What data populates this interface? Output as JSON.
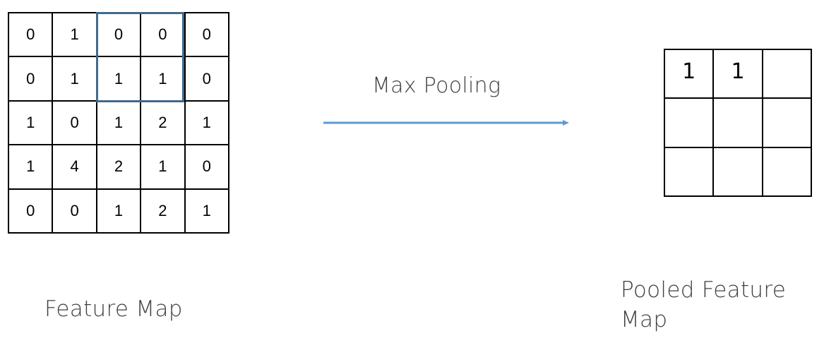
{
  "feature_map": {
    "caption": "Feature Map",
    "rows": [
      [
        "0",
        "1",
        "0",
        "0",
        "0"
      ],
      [
        "0",
        "1",
        "1",
        "1",
        "0"
      ],
      [
        "1",
        "0",
        "1",
        "2",
        "1"
      ],
      [
        "1",
        "4",
        "2",
        "1",
        "0"
      ],
      [
        "0",
        "0",
        "1",
        "2",
        "1"
      ]
    ],
    "highlight_window": {
      "rows": [
        0,
        1
      ],
      "cols": [
        2,
        3
      ],
      "color": "#3f6a8c"
    }
  },
  "operation": {
    "label": "Max Pooling",
    "arrow_color": "#5b9bd5"
  },
  "pooled_feature_map": {
    "caption": "Pooled Feature Map",
    "rows": [
      [
        "1",
        "1",
        ""
      ],
      [
        "",
        "",
        ""
      ],
      [
        "",
        "",
        ""
      ]
    ]
  }
}
